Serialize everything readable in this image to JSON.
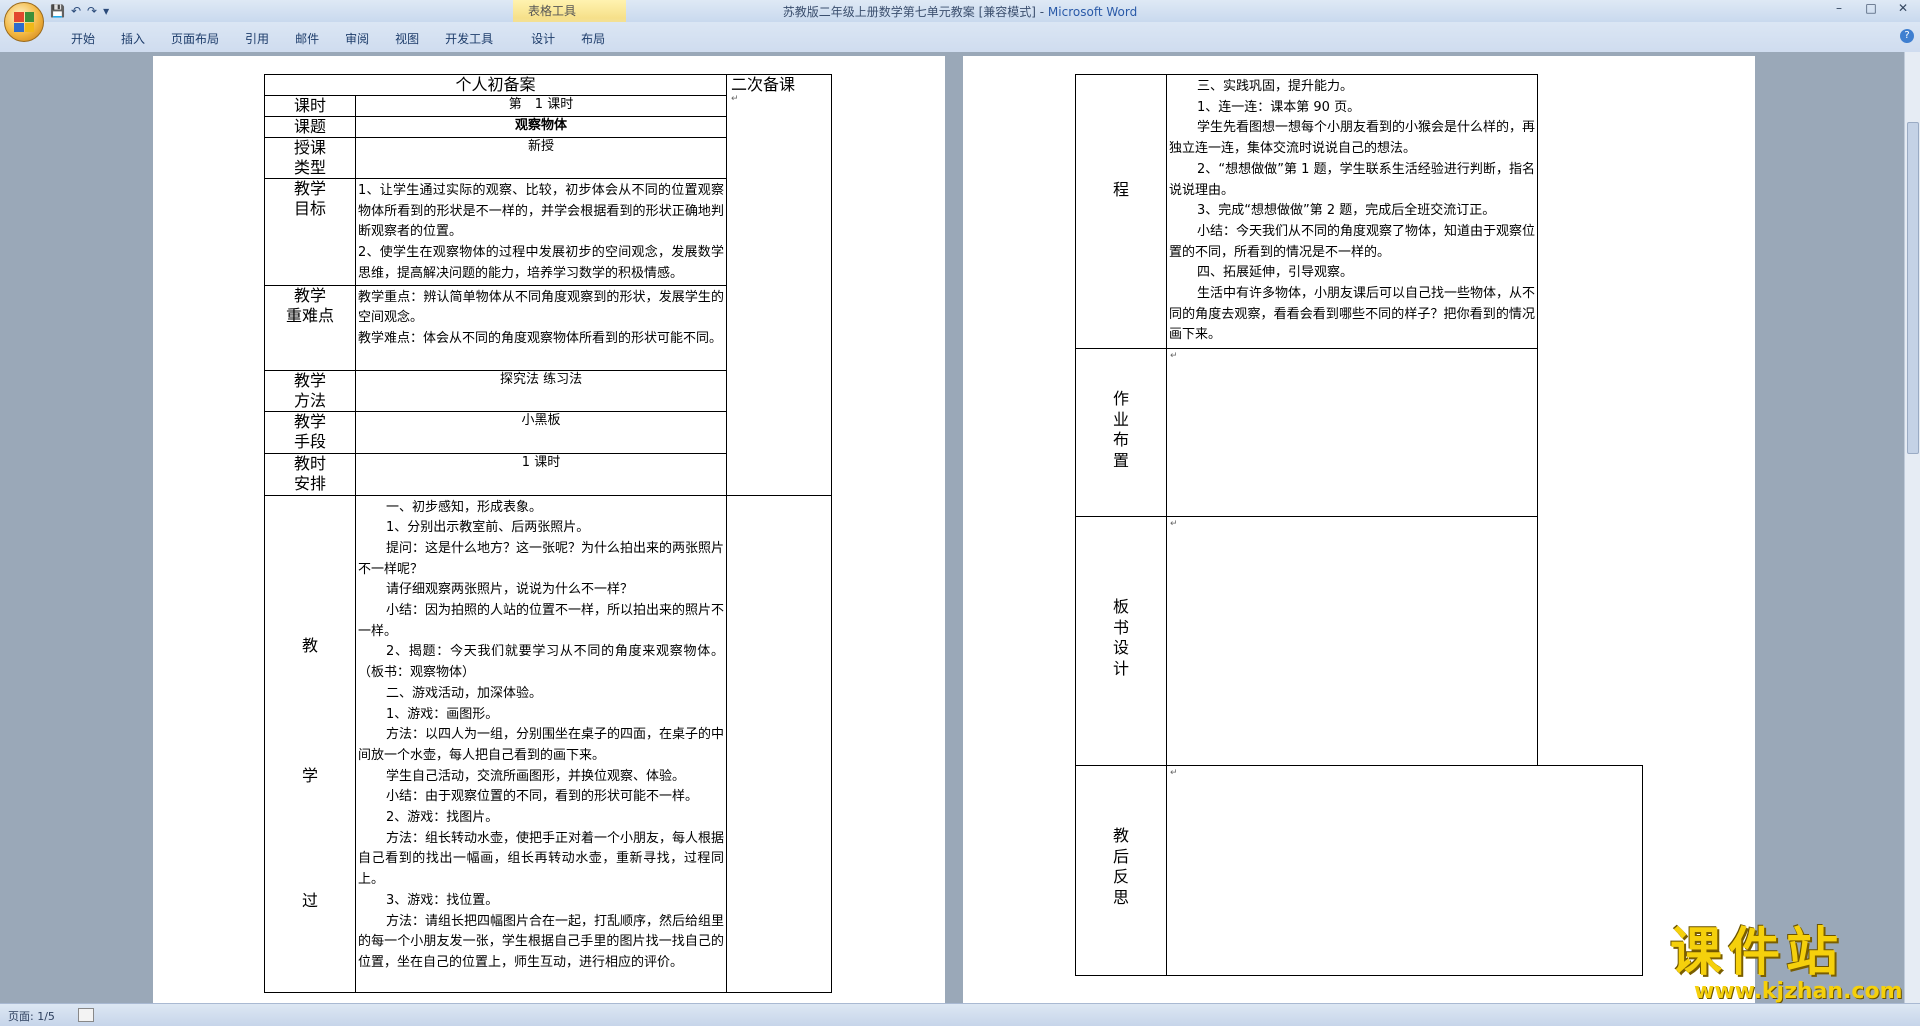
{
  "window": {
    "title": "苏教版二年级上册数学第七单元教案 [兼容模式] - ",
    "app_name": "Microsoft Word",
    "context_tab_group": "表格工具",
    "ribbon_tabs": [
      "开始",
      "插入",
      "页面布局",
      "引用",
      "邮件",
      "审阅",
      "视图",
      "开发工具",
      "设计",
      "布局"
    ],
    "minimize": "–",
    "maximize": "□",
    "close": "✕",
    "help": "?"
  },
  "status": {
    "page": "页面: 1/5"
  },
  "marks": {
    "para": "↵",
    "cell": "↵"
  },
  "left_page": {
    "header_personal": "个人初备案",
    "header_second": "二次备课",
    "rows": {
      "period_label": "课时",
      "period_value": "第　1 课时",
      "topic_label": "课题",
      "topic_value": "观察物体",
      "type_label": [
        "授课",
        "类型"
      ],
      "type_value": "新授",
      "goal_label": [
        "教学",
        "目标"
      ],
      "goal_text": [
        "1、让学生通过实际的观察、比较，初步体会从不同的位置观察物体所看到的形状是不一样的，并学会根据看到的形状正确地判断观察者的位置。",
        "2、使学生在观察物体的过程中发展初步的空间观念，发展数学思维，提高解决问题的能力，培养学习数学的积极情感。"
      ],
      "key_label": [
        "教学",
        "重难点"
      ],
      "key_text": [
        "教学重点：辨认简单物体从不同角度观察到的形状，发展学生的空间观念。",
        "教学难点：体会从不同的角度观察物体所看到的形状可能不同。"
      ],
      "method_label": [
        "教学",
        "方法"
      ],
      "method_value": "探究法 练习法",
      "means_label": [
        "教学",
        "手段"
      ],
      "means_value": "小黑板",
      "time_label": [
        "教时",
        "安排"
      ],
      "time_value": "1 课时",
      "process_label": [
        "教",
        "学",
        "过"
      ],
      "process_text": [
        "一、初步感知，形成表象。",
        "1、分别出示教室前、后两张照片。",
        "提问：这是什么地方？这一张呢？为什么拍出来的两张照片不一样呢？",
        "请仔细观察两张照片，说说为什么不一样？",
        "小结：因为拍照的人站的位置不一样，所以拍出来的照片不一样。",
        "2、揭题：今天我们就要学习从不同的角度来观察物体。（板书：观察物体）",
        "二、游戏活动，加深体验。",
        "1、游戏：画图形。",
        "方法：以四人为一组，分别围坐在桌子的四面，在桌子的中间放一个水壶，每人把自己看到的画下来。",
        "学生自己活动，交流所画图形，并换位观察、体验。",
        "小结：由于观察位置的不同，看到的形状可能不一样。",
        "2、游戏：找图片。",
        "方法：组长转动水壶，使把手正对着一个小朋友，每人根据自己看到的找出一幅画，组长再转动水壶，重新寻找，过程同上。",
        "3、游戏：找位置。",
        "方法：请组长把四幅图片合在一起，打乱顺序，然后给组里的每一个小朋友发一张，学生根据自己手里的图片找一找自己的位置，坐在自己的位置上，师生互动，进行相应的评价。"
      ]
    }
  },
  "right_page": {
    "process_label": "程",
    "process_text": [
      "三、实践巩固，提升能力。",
      "1、连一连：课本第 90 页。",
      "学生先看图想一想每个小朋友看到的小猴会是什么样的，再独立连一连，集体交流时说说自己的想法。",
      "2、“想想做做”第 1 题，学生联系生活经验进行判断，指名说说理由。",
      "3、完成“想想做做”第 2 题，完成后全班交流订正。",
      "小结：今天我们从不同的角度观察了物体，知道由于观察位置的不同，所看到的情况是不一样的。",
      "四、拓展延伸，引导观察。",
      "生活中有许多物体，小朋友课后可以自己找一些物体，从不同的角度去观察，看看会看到哪些不同的样子？把你看到的情况画下来。"
    ],
    "homework_label": [
      "作",
      "业",
      "布",
      "置"
    ],
    "board_label": [
      "板",
      "书",
      "设",
      "计"
    ],
    "reflection_label": [
      "教",
      "后",
      "反",
      "思"
    ]
  },
  "watermark": {
    "text": "课件站",
    "url": "www.kjzhan.com"
  },
  "colors": {
    "titlebar": "#c9d9ee",
    "workspace": "#9aa8b8",
    "context_tab": "#f6e08a",
    "watermark": "#f5d00c"
  }
}
